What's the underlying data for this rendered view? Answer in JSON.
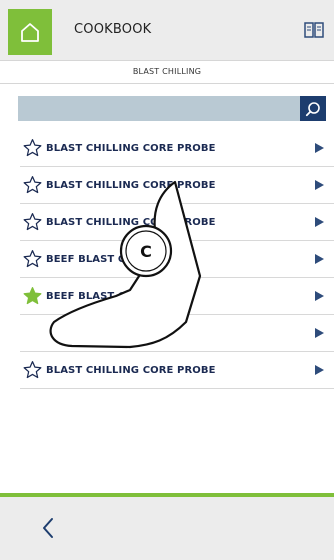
{
  "header": {
    "title": "COOKBOOK",
    "home_icon": "home-icon",
    "book_icon": "book-icon"
  },
  "subheader": {
    "title": "BLAST CHILLING"
  },
  "search": {
    "value": "",
    "placeholder": "",
    "icon": "search-icon"
  },
  "list": {
    "items": [
      {
        "label": "BLAST CHILLING CORE PROBE",
        "favorite": false
      },
      {
        "label": "BLAST CHILLING CORE PROBE",
        "favorite": false
      },
      {
        "label": "BLAST CHILLING CORE PROBE",
        "favorite": false
      },
      {
        "label": "BEEF BLAST CHILLING",
        "favorite": false
      },
      {
        "label": "BEEF BLAST CHILLING",
        "favorite": true
      },
      {
        "label": "",
        "favorite": false
      },
      {
        "label": "BLAST CHILLING CORE PROBE",
        "favorite": false
      }
    ]
  },
  "overlay": {
    "callout": "C",
    "icon": "tap-hand-icon"
  },
  "footer": {
    "back_icon": "chevron-left-icon"
  },
  "colors": {
    "accent": "#7fbf3a",
    "navy": "#1d3d6e",
    "search_bg": "#b9c9d3",
    "text": "#1b2a52"
  }
}
